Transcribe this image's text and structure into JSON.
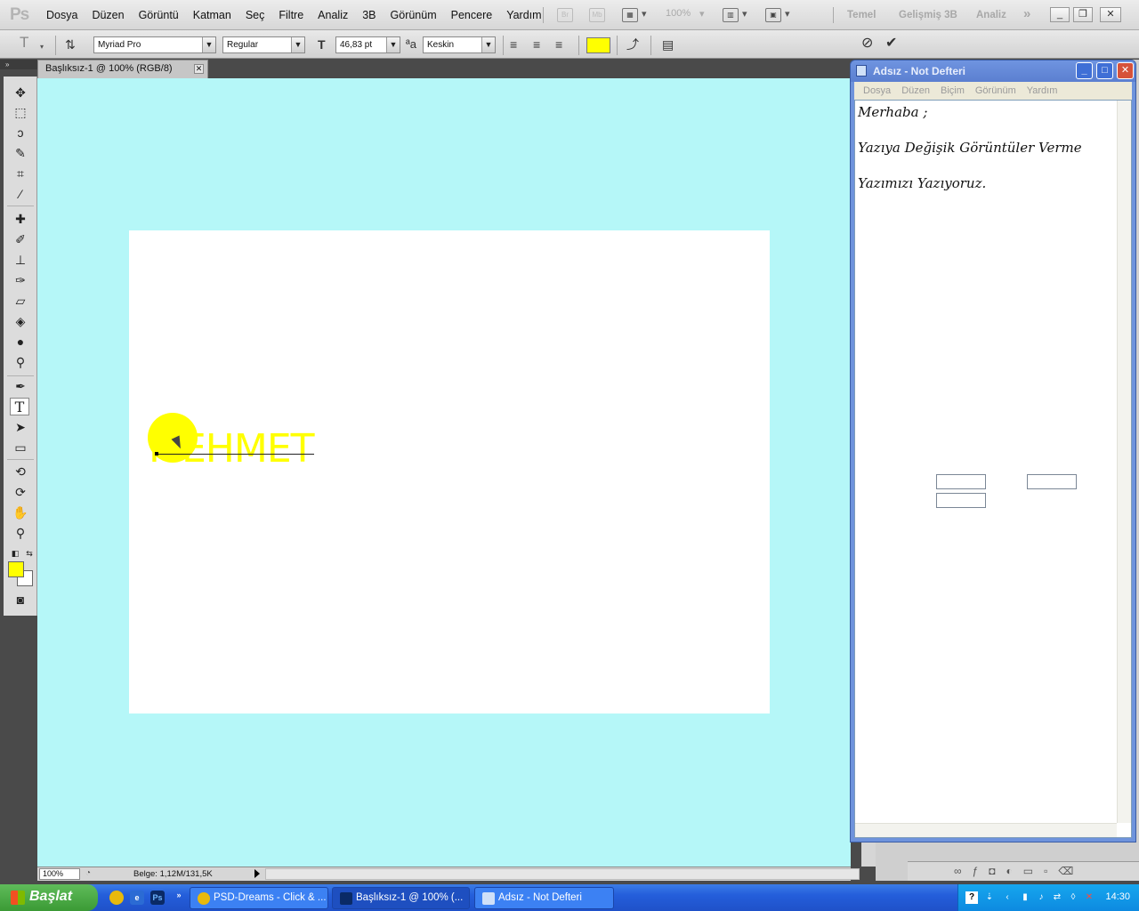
{
  "app": {
    "logo": "Ps",
    "menu": [
      "Dosya",
      "Düzen",
      "Görüntü",
      "Katman",
      "Seç",
      "Filtre",
      "Analiz",
      "3B",
      "Görünüm",
      "Pencere",
      "Yardım"
    ],
    "zoom_menu": "100%",
    "workspaces": [
      "Temel",
      "Gelişmiş 3B",
      "Analiz"
    ],
    "more": "»"
  },
  "options": {
    "font_family": "Myriad Pro",
    "font_style": "Regular",
    "font_size": "46,83 pt",
    "antialias": "Keskin",
    "text_color": "#ffff00"
  },
  "document": {
    "tab_title": "Başlıksız-1 @ 100% (RGB/8)",
    "text_layer": "MEHMET",
    "canvas_bg": "#b5f7f8"
  },
  "status": {
    "zoom": "100%",
    "doc_info": "Belge: 1,12M/131,5K"
  },
  "notepad": {
    "title": "Adsız - Not Defteri",
    "menu": [
      "Dosya",
      "Düzen",
      "Biçim",
      "Görünüm",
      "Yardım"
    ],
    "lines": [
      "Merhaba ;",
      "Yazıya Değişik Görüntüler Verme",
      "Yazımızı Yazıyoruz."
    ]
  },
  "taskbar": {
    "start": "Başlat",
    "tasks": [
      "PSD-Dreams - Click & ...",
      "Başlıksız-1 @ 100% (...",
      "Adsız - Not Defteri"
    ],
    "clock": "14:30"
  },
  "icons": [
    "move-tool-icon",
    "marquee-tool-icon",
    "lasso-tool-icon",
    "quick-select-icon",
    "crop-tool-icon",
    "eyedropper-icon",
    "healing-brush-icon",
    "brush-tool-icon",
    "clone-stamp-icon",
    "history-brush-icon",
    "eraser-icon",
    "paint-bucket-icon",
    "blur-tool-icon",
    "dodge-tool-icon",
    "pen-tool-icon",
    "type-tool-icon",
    "path-select-icon",
    "rectangle-tool-icon",
    "3d-rotate-icon",
    "3d-orbit-icon",
    "hand-tool-icon",
    "zoom-tool-icon",
    "quick-mask-icon"
  ]
}
